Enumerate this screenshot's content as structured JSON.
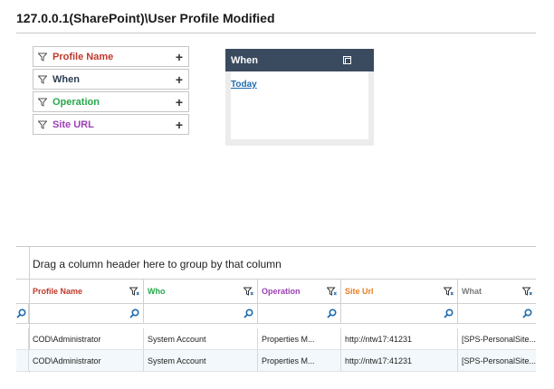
{
  "page": {
    "title": "127.0.0.1(SharePoint)\\User Profile Modified"
  },
  "filters": [
    {
      "label": "Profile Name",
      "color": "#c0392b",
      "plus": "+"
    },
    {
      "label": "When",
      "color": "#2c3e50",
      "plus": "+"
    },
    {
      "label": "Operation",
      "color": "#27a84a",
      "plus": "+"
    },
    {
      "label": "Site URL",
      "color": "#9b3fb5",
      "plus": "+"
    }
  ],
  "when_panel": {
    "title": "When",
    "link": "Today"
  },
  "grid": {
    "group_hint": "Drag a column header here to group by that column",
    "columns": [
      {
        "label": "Profile Name",
        "color": "#c0392b"
      },
      {
        "label": "Who",
        "color": "#27a84a"
      },
      {
        "label": "Operation",
        "color": "#9b3fb5"
      },
      {
        "label": "Site Url",
        "color": "#e67e22"
      },
      {
        "label": "What",
        "color": "#7a7a7a"
      }
    ],
    "rows": [
      {
        "profile_name": "COD\\Administrator",
        "who": "System Account",
        "operation": "Properties M...",
        "site_url": "http://ntw17:41231",
        "what": "[SPS-PersonalSite..."
      },
      {
        "profile_name": "COD\\Administrator",
        "who": "System Account",
        "operation": "Properties M...",
        "site_url": "http://ntw17:41231",
        "what": "[SPS-PersonalSite..."
      }
    ]
  },
  "colors": {
    "accent_blue": "#1e6bb0",
    "header_dark": "#3a4a5f",
    "row_alt": "#f2f8fb"
  }
}
